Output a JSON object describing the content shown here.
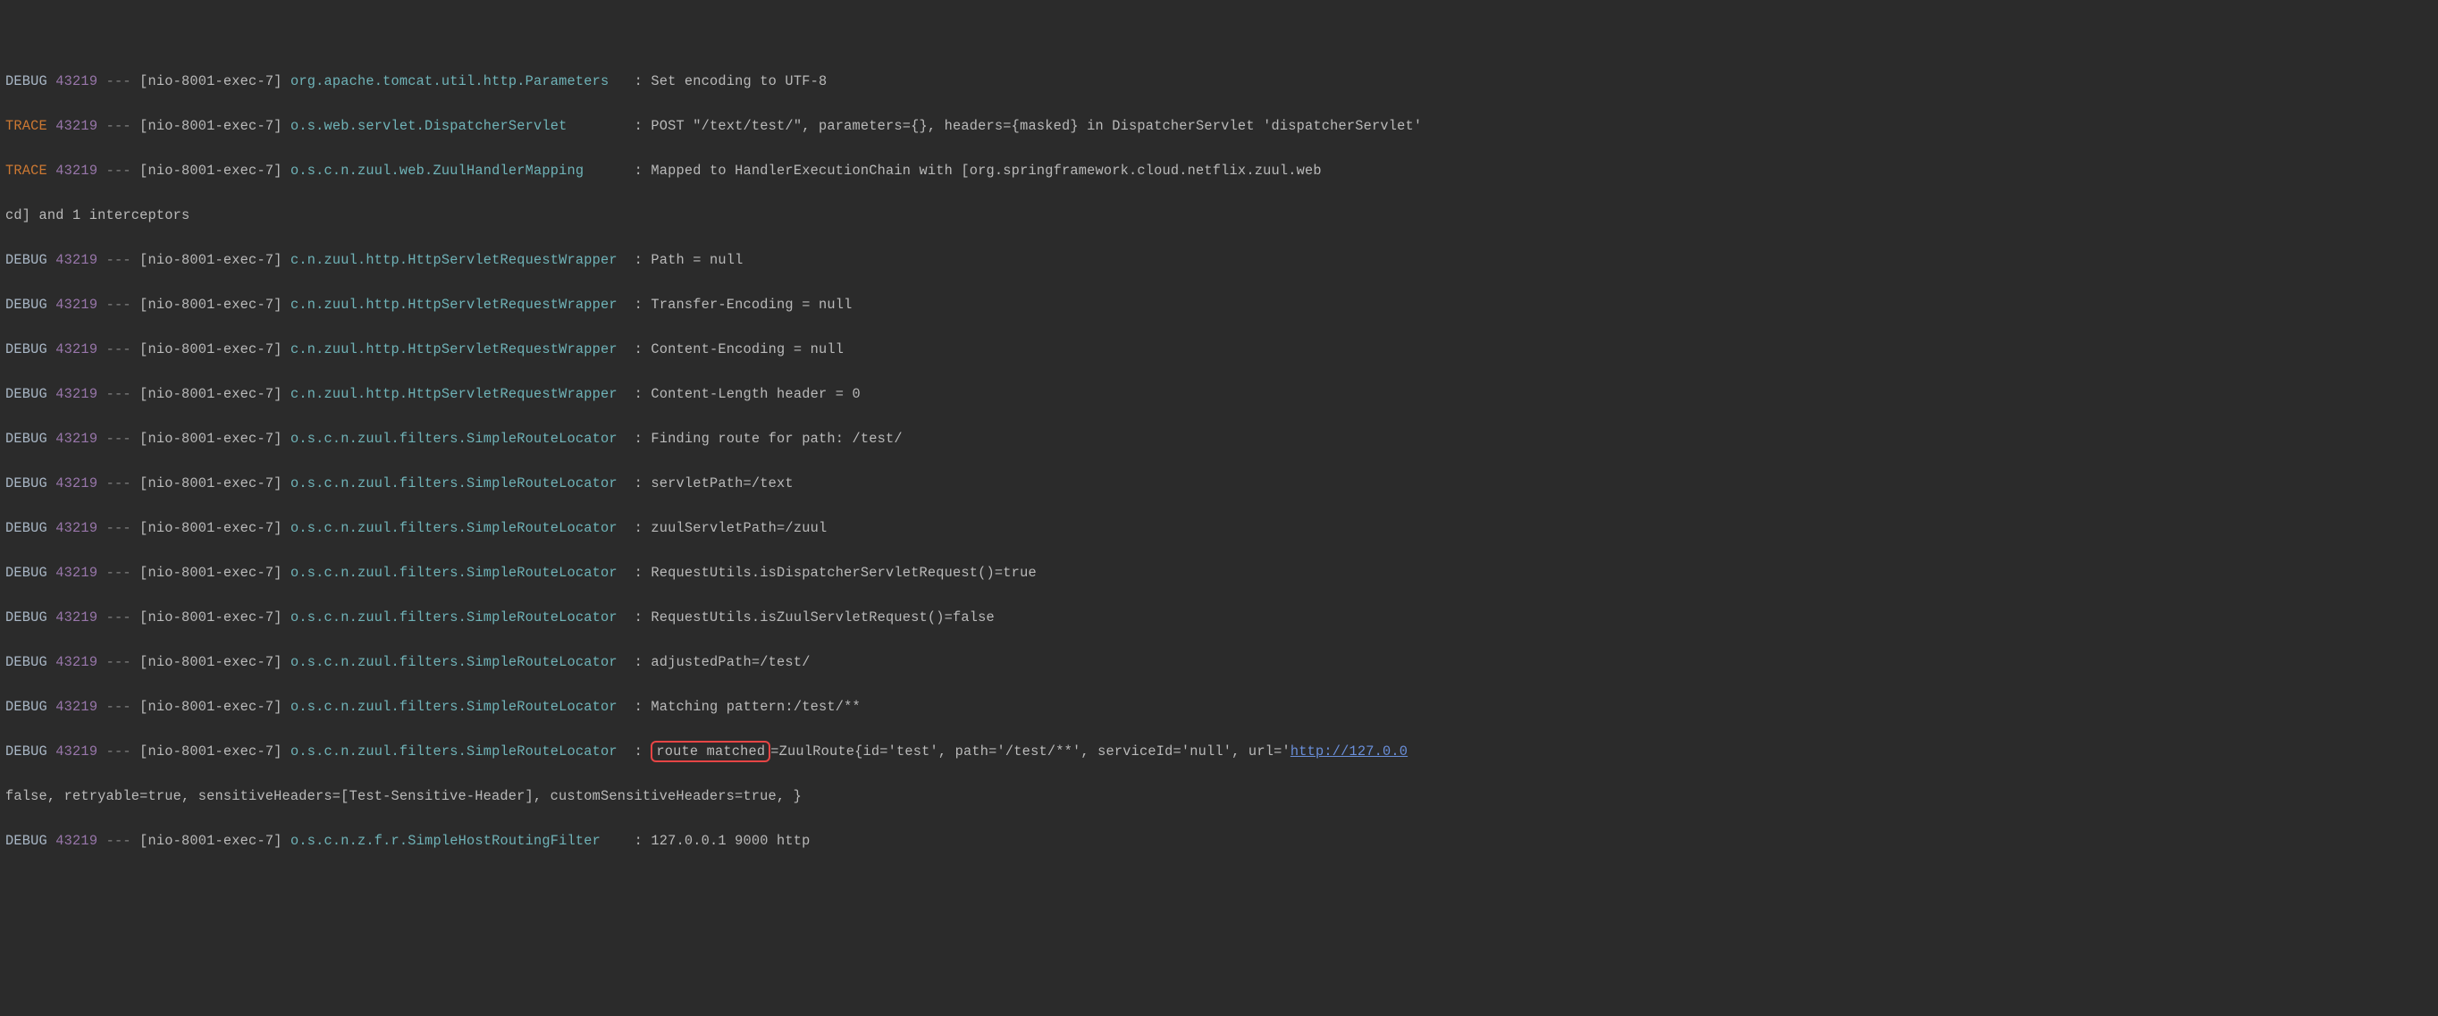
{
  "dash": "---",
  "colors": {
    "bg": "#2b2b2b",
    "fg": "#bababa",
    "class": "#6fb3b8",
    "pid": "#9876aa",
    "trace": "#cc7832",
    "link": "#6a8fd9",
    "highlight_border": "#e64545"
  },
  "class_column_width": 40,
  "lines": [
    {
      "level": "DEBUG",
      "pid": "43219",
      "thread": "[nio-8001-exec-7]",
      "cls": "org.apache.tomcat.util.http.Parameters",
      "pad": "  ",
      "msg": "Set encoding to UTF-8"
    },
    {
      "level": "TRACE",
      "pid": "43219",
      "thread": "[nio-8001-exec-7]",
      "cls": "o.s.web.servlet.DispatcherServlet",
      "pad": "       ",
      "msg": "POST \"/text/test/\", parameters={}, headers={masked} in DispatcherServlet 'dispatcherServlet'"
    },
    {
      "level": "TRACE",
      "pid": "43219",
      "thread": "[nio-8001-exec-7]",
      "cls": "o.s.c.n.zuul.web.ZuulHandlerMapping",
      "pad": "     ",
      "msg": "Mapped to HandlerExecutionChain with [org.springframework.cloud.netflix.zuul.web"
    },
    {
      "msg": "cd] and 1 interceptors"
    },
    {
      "level": "DEBUG",
      "pid": "43219",
      "thread": "[nio-8001-exec-7]",
      "cls": "c.n.zuul.http.HttpServletRequestWrapper",
      "pad": " ",
      "msg": "Path = null"
    },
    {
      "level": "DEBUG",
      "pid": "43219",
      "thread": "[nio-8001-exec-7]",
      "cls": "c.n.zuul.http.HttpServletRequestWrapper",
      "pad": " ",
      "msg": "Transfer-Encoding = null"
    },
    {
      "level": "DEBUG",
      "pid": "43219",
      "thread": "[nio-8001-exec-7]",
      "cls": "c.n.zuul.http.HttpServletRequestWrapper",
      "pad": " ",
      "msg": "Content-Encoding = null"
    },
    {
      "level": "DEBUG",
      "pid": "43219",
      "thread": "[nio-8001-exec-7]",
      "cls": "c.n.zuul.http.HttpServletRequestWrapper",
      "pad": " ",
      "msg": "Content-Length header = 0"
    },
    {
      "level": "DEBUG",
      "pid": "43219",
      "thread": "[nio-8001-exec-7]",
      "cls": "o.s.c.n.zuul.filters.SimpleRouteLocator",
      "pad": " ",
      "msg": "Finding route for path: /test/"
    },
    {
      "level": "DEBUG",
      "pid": "43219",
      "thread": "[nio-8001-exec-7]",
      "cls": "o.s.c.n.zuul.filters.SimpleRouteLocator",
      "pad": " ",
      "msg": "servletPath=/text"
    },
    {
      "level": "DEBUG",
      "pid": "43219",
      "thread": "[nio-8001-exec-7]",
      "cls": "o.s.c.n.zuul.filters.SimpleRouteLocator",
      "pad": " ",
      "msg": "zuulServletPath=/zuul"
    },
    {
      "level": "DEBUG",
      "pid": "43219",
      "thread": "[nio-8001-exec-7]",
      "cls": "o.s.c.n.zuul.filters.SimpleRouteLocator",
      "pad": " ",
      "msg": "RequestUtils.isDispatcherServletRequest()=true"
    },
    {
      "level": "DEBUG",
      "pid": "43219",
      "thread": "[nio-8001-exec-7]",
      "cls": "o.s.c.n.zuul.filters.SimpleRouteLocator",
      "pad": " ",
      "msg": "RequestUtils.isZuulServletRequest()=false"
    },
    {
      "level": "DEBUG",
      "pid": "43219",
      "thread": "[nio-8001-exec-7]",
      "cls": "o.s.c.n.zuul.filters.SimpleRouteLocator",
      "pad": " ",
      "msg": "adjustedPath=/test/"
    },
    {
      "level": "DEBUG",
      "pid": "43219",
      "thread": "[nio-8001-exec-7]",
      "cls": "o.s.c.n.zuul.filters.SimpleRouteLocator",
      "pad": " ",
      "msg": "Matching pattern:/test/**"
    },
    {
      "level": "DEBUG",
      "pid": "43219",
      "thread": "[nio-8001-exec-7]",
      "cls": "o.s.c.n.zuul.filters.SimpleRouteLocator",
      "pad": " ",
      "box": "route matched",
      "msg": "=ZuulRoute{id='test', path='/test/**', serviceId='null', url='",
      "link": "http://127.0.0"
    },
    {
      "msg": "false, retryable=true, sensitiveHeaders=[Test-Sensitive-Header], customSensitiveHeaders=true, }"
    },
    {
      "level": "DEBUG",
      "pid": "43219",
      "thread": "[nio-8001-exec-7]",
      "cls": "o.s.c.n.z.f.r.SimpleHostRoutingFilter",
      "pad": "   ",
      "msg": "127.0.0.1 9000 http"
    }
  ]
}
